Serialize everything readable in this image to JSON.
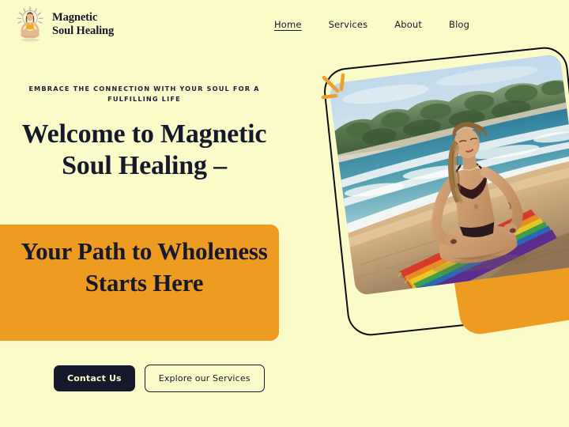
{
  "theme": {
    "background": "#FAFBC9",
    "accent_orange": "#ED9B21",
    "ink": "#16182C",
    "button_dark": "#16182B"
  },
  "header": {
    "brand": {
      "icon": "meditating-figure-logo",
      "line1": "Magnetic",
      "line2": "Soul Healing"
    },
    "nav": [
      {
        "label": "Home",
        "active": true
      },
      {
        "label": "Services",
        "active": false
      },
      {
        "label": "About",
        "active": false
      },
      {
        "label": "Blog",
        "active": false
      }
    ]
  },
  "hero": {
    "eyebrow": "EMBRACE THE CONNECTION WITH YOUR SOUL FOR A FULFILLING LIFE",
    "headline": "Welcome to Magnetic Soul Healing –",
    "headline_highlight": "Your Path to Wholeness Starts Here",
    "cta_primary": "Contact Us",
    "cta_secondary": "Explore our Services",
    "image_alt": "woman-meditating-lotus-pose-on-rainbow-beach-towel",
    "decorations": {
      "spark": "orange-sparkle-icon",
      "outline_shape": "dark-outline-rounded-shape",
      "orange_shape": "orange-rounded-blob"
    }
  }
}
